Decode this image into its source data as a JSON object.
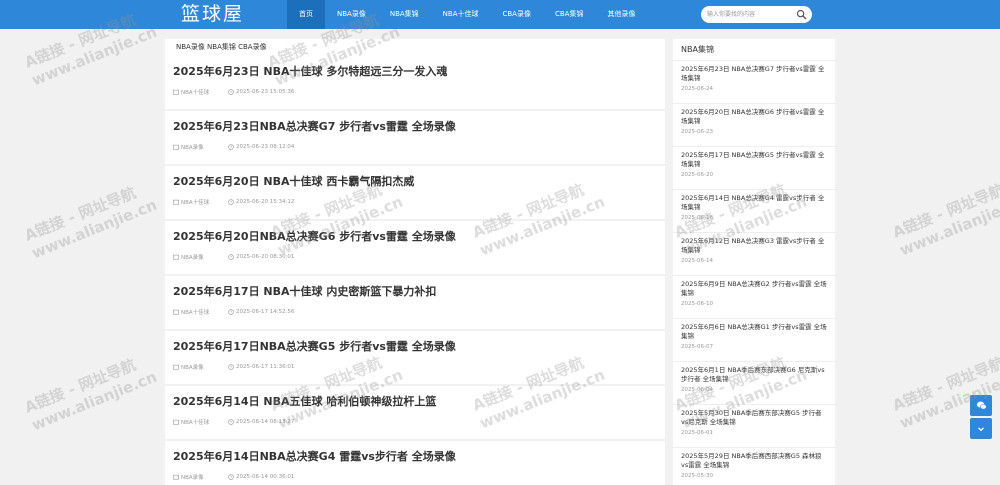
{
  "header": {
    "logo": "篮球屋",
    "nav": [
      "首页",
      "NBA录像",
      "NBA集锦",
      "NBA十佳球",
      "CBA录像",
      "CBA集锦",
      "其他录像"
    ],
    "active_index": 0,
    "search_placeholder": "输入你要找的内容"
  },
  "breadcrumb": "NBA录像 NBA集锦 CBA录像",
  "articles": [
    {
      "title": "2025年6月23日 NBA十佳球 多尔特超远三分一发入魂",
      "category": "NBA十佳球",
      "time": "2025-06-23 15:05:36"
    },
    {
      "title": "2025年6月23日NBA总决赛G7 步行者vs雷霆 全场录像",
      "category": "NBA录像",
      "time": "2025-06-23 08:12:04"
    },
    {
      "title": "2025年6月20日 NBA十佳球 西卡霸气隔扣杰威",
      "category": "NBA十佳球",
      "time": "2025-06-20 15:34:12"
    },
    {
      "title": "2025年6月20日NBA总决赛G6 步行者vs雷霆 全场录像",
      "category": "NBA录像",
      "time": "2025-06-20 08:30:01"
    },
    {
      "title": "2025年6月17日 NBA十佳球 内史密斯篮下暴力补扣",
      "category": "NBA十佳球",
      "time": "2025-06-17 14:52:56"
    },
    {
      "title": "2025年6月17日NBA总决赛G5 步行者vs雷霆 全场录像",
      "category": "NBA录像",
      "time": "2025-06-17 11:36:01"
    },
    {
      "title": "2025年6月14日 NBA五佳球 哈利伯顿神级拉杆上篮",
      "category": "NBA十佳球",
      "time": "2025-06-14 08:13:27"
    },
    {
      "title": "2025年6月14日NBA总决赛G4 雷霆vs步行者 全场录像",
      "category": "NBA录像",
      "time": "2025-06-14 00:36:01"
    }
  ],
  "sidebar": {
    "title": "NBA集锦",
    "items": [
      {
        "title": "2025年6月23日 NBA总决赛G7 步行者vs雷霆 全场集锦",
        "date": "2025-06-24"
      },
      {
        "title": "2025年6月20日 NBA总决赛G6 步行者vs雷霆 全场集锦",
        "date": "2025-06-23"
      },
      {
        "title": "2025年6月17日 NBA总决赛G5 步行者vs雷霆 全场集锦",
        "date": "2025-06-20"
      },
      {
        "title": "2025年6月14日 NBA总决赛G4 雷霆vs步行者 全场集锦",
        "date": "2025-06-16"
      },
      {
        "title": "2025年6月12日 NBA总决赛G3 雷霆vs步行者 全场集锦",
        "date": "2025-06-14"
      },
      {
        "title": "2025年6月9日 NBA总决赛G2 步行者vs雷霆 全场集锦",
        "date": "2025-06-10"
      },
      {
        "title": "2025年6月6日 NBA总决赛G1 步行者vs雷霆 全场集锦",
        "date": "2025-06-07"
      },
      {
        "title": "2025年6月1日 NBA季后赛东部决赛G6 尼克斯vs步行者 全场集锦",
        "date": "2025-06-04"
      },
      {
        "title": "2025年5月30日 NBA季后赛东部决赛G5 步行者vs尼克斯 全场集锦",
        "date": "2025-06-01"
      },
      {
        "title": "2025年5月29日 NBA季后赛西部决赛G5 森林狼vs雷霆 全场集锦",
        "date": "2025-05-30"
      }
    ]
  },
  "watermark": {
    "line1": "A链接 - 网址导航",
    "line2": "www.alianjie.cn"
  },
  "colors": {
    "header": "#2e87d8",
    "nav_active": "#1c6fbb",
    "background": "#f1f1f1"
  }
}
